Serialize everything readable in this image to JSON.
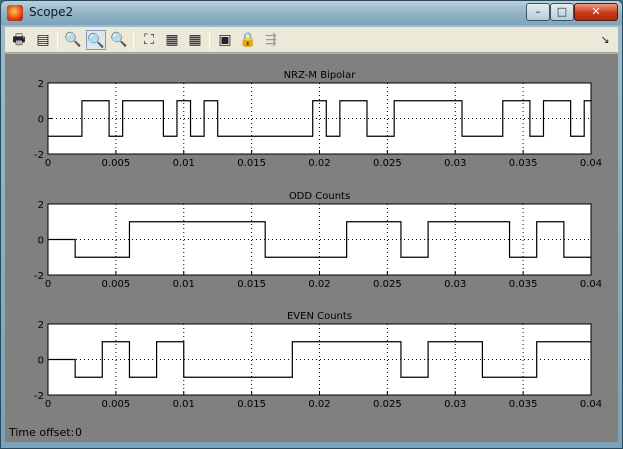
{
  "window": {
    "title": "Scope2",
    "controls": {
      "minimize": "–",
      "maximize": "□",
      "close": "✕"
    }
  },
  "toolbar": {
    "buttons": [
      {
        "name": "print-icon",
        "glyph": "🖶"
      },
      {
        "name": "parameters-icon",
        "glyph": "▤"
      },
      {
        "name": "zoom-icon",
        "glyph": "🔍"
      },
      {
        "name": "zoom-x-icon",
        "glyph": "🔍"
      },
      {
        "name": "zoom-y-icon",
        "glyph": "🔍"
      },
      {
        "name": "autoscale-icon",
        "glyph": "⛶"
      },
      {
        "name": "save-axes-icon",
        "glyph": "▦"
      },
      {
        "name": "restore-axes-icon",
        "glyph": "▦"
      },
      {
        "name": "floating-scope-icon",
        "glyph": "▣"
      },
      {
        "name": "lock-icon",
        "glyph": "🔒"
      },
      {
        "name": "signal-selection-icon",
        "glyph": "⇶"
      }
    ],
    "dock_glyph": "↘"
  },
  "status": {
    "label": "Time offset:",
    "value": "0"
  },
  "chart_data": [
    {
      "type": "line",
      "step": true,
      "title": "NRZ-M Bipolar",
      "xlim": [
        0,
        0.04
      ],
      "ylim": [
        -2,
        2
      ],
      "xticks": [
        "0",
        "0.005",
        "0.01",
        "0.015",
        "0.02",
        "0.025",
        "0.03",
        "0.035",
        "0.04"
      ],
      "yticks": [
        "2",
        "0",
        "-2"
      ],
      "grid": true,
      "series": [
        {
          "color": "#000000",
          "t": [
            0,
            0.0025,
            0.0045,
            0.0055,
            0.0085,
            0.0095,
            0.0105,
            0.0115,
            0.0125,
            0.0145,
            0.0195,
            0.0205,
            0.0215,
            0.0235,
            0.0255,
            0.0305,
            0.0335,
            0.0355,
            0.0365,
            0.0385,
            0.0395
          ],
          "y": [
            -1,
            1,
            -1,
            1,
            -1,
            1,
            -1,
            1,
            -1,
            -1,
            1,
            -1,
            1,
            -1,
            1,
            -1,
            1,
            -1,
            1,
            -1,
            1
          ]
        }
      ]
    },
    {
      "type": "line",
      "step": true,
      "title": "ODD Counts",
      "xlim": [
        0,
        0.04
      ],
      "ylim": [
        -2,
        2
      ],
      "xticks": [
        "0",
        "0.005",
        "0.01",
        "0.015",
        "0.02",
        "0.025",
        "0.03",
        "0.035",
        "0.04"
      ],
      "yticks": [
        "2",
        "0",
        "-2"
      ],
      "grid": true,
      "series": [
        {
          "color": "#000000",
          "t": [
            0,
            0.002,
            0.006,
            0.016,
            0.022,
            0.026,
            0.028,
            0.034,
            0.036,
            0.038
          ],
          "y": [
            0,
            -1,
            1,
            -1,
            1,
            -1,
            1,
            -1,
            1,
            -1
          ]
        }
      ]
    },
    {
      "type": "line",
      "step": true,
      "title": "EVEN Counts",
      "xlim": [
        0,
        0.04
      ],
      "ylim": [
        -2,
        2
      ],
      "xticks": [
        "0",
        "0.005",
        "0.01",
        "0.015",
        "0.02",
        "0.025",
        "0.03",
        "0.035",
        "0.04"
      ],
      "yticks": [
        "2",
        "0",
        "-2"
      ],
      "grid": true,
      "series": [
        {
          "color": "#000000",
          "t": [
            0,
            0.002,
            0.004,
            0.006,
            0.008,
            0.01,
            0.016,
            0.018,
            0.024,
            0.026,
            0.028,
            0.032,
            0.036
          ],
          "y": [
            0,
            -1,
            1,
            -1,
            1,
            -1,
            -1,
            1,
            1,
            -1,
            1,
            -1,
            1
          ]
        }
      ]
    }
  ]
}
